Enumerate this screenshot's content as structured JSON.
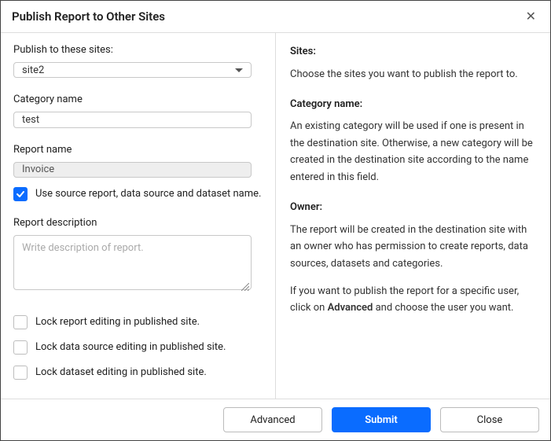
{
  "dialog": {
    "title": "Publish Report to Other Sites"
  },
  "form": {
    "sites_label": "Publish to these sites:",
    "sites_value": "site2",
    "category_label": "Category name",
    "category_value": "test",
    "reportname_label": "Report name",
    "reportname_value": "Invoice",
    "use_source_label": "Use source report, data source and dataset name.",
    "desc_label": "Report description",
    "desc_placeholder": "Write description of report.",
    "desc_value": "",
    "lock_report_label": "Lock report editing in published site.",
    "lock_datasource_label": "Lock data source editing in published site.",
    "lock_dataset_label": "Lock dataset editing in published site."
  },
  "help": {
    "sites_h": "Sites:",
    "sites_p": "Choose the sites you want to publish the report to.",
    "category_h": "Category name:",
    "category_p": "An existing category will be used if one is present in the destination site. Otherwise, a new category will be created in the destination site according to the name entered in this field.",
    "owner_h": "Owner:",
    "owner_p1": "The report will be created in the destination site with an owner who has permission to create reports, data sources, datasets and categories.",
    "owner_p2a": "If you want to publish the report for a specific user, click on ",
    "owner_p2b": "Advanced",
    "owner_p2c": " and choose the user you want."
  },
  "footer": {
    "advanced": "Advanced",
    "submit": "Submit",
    "close": "Close"
  }
}
